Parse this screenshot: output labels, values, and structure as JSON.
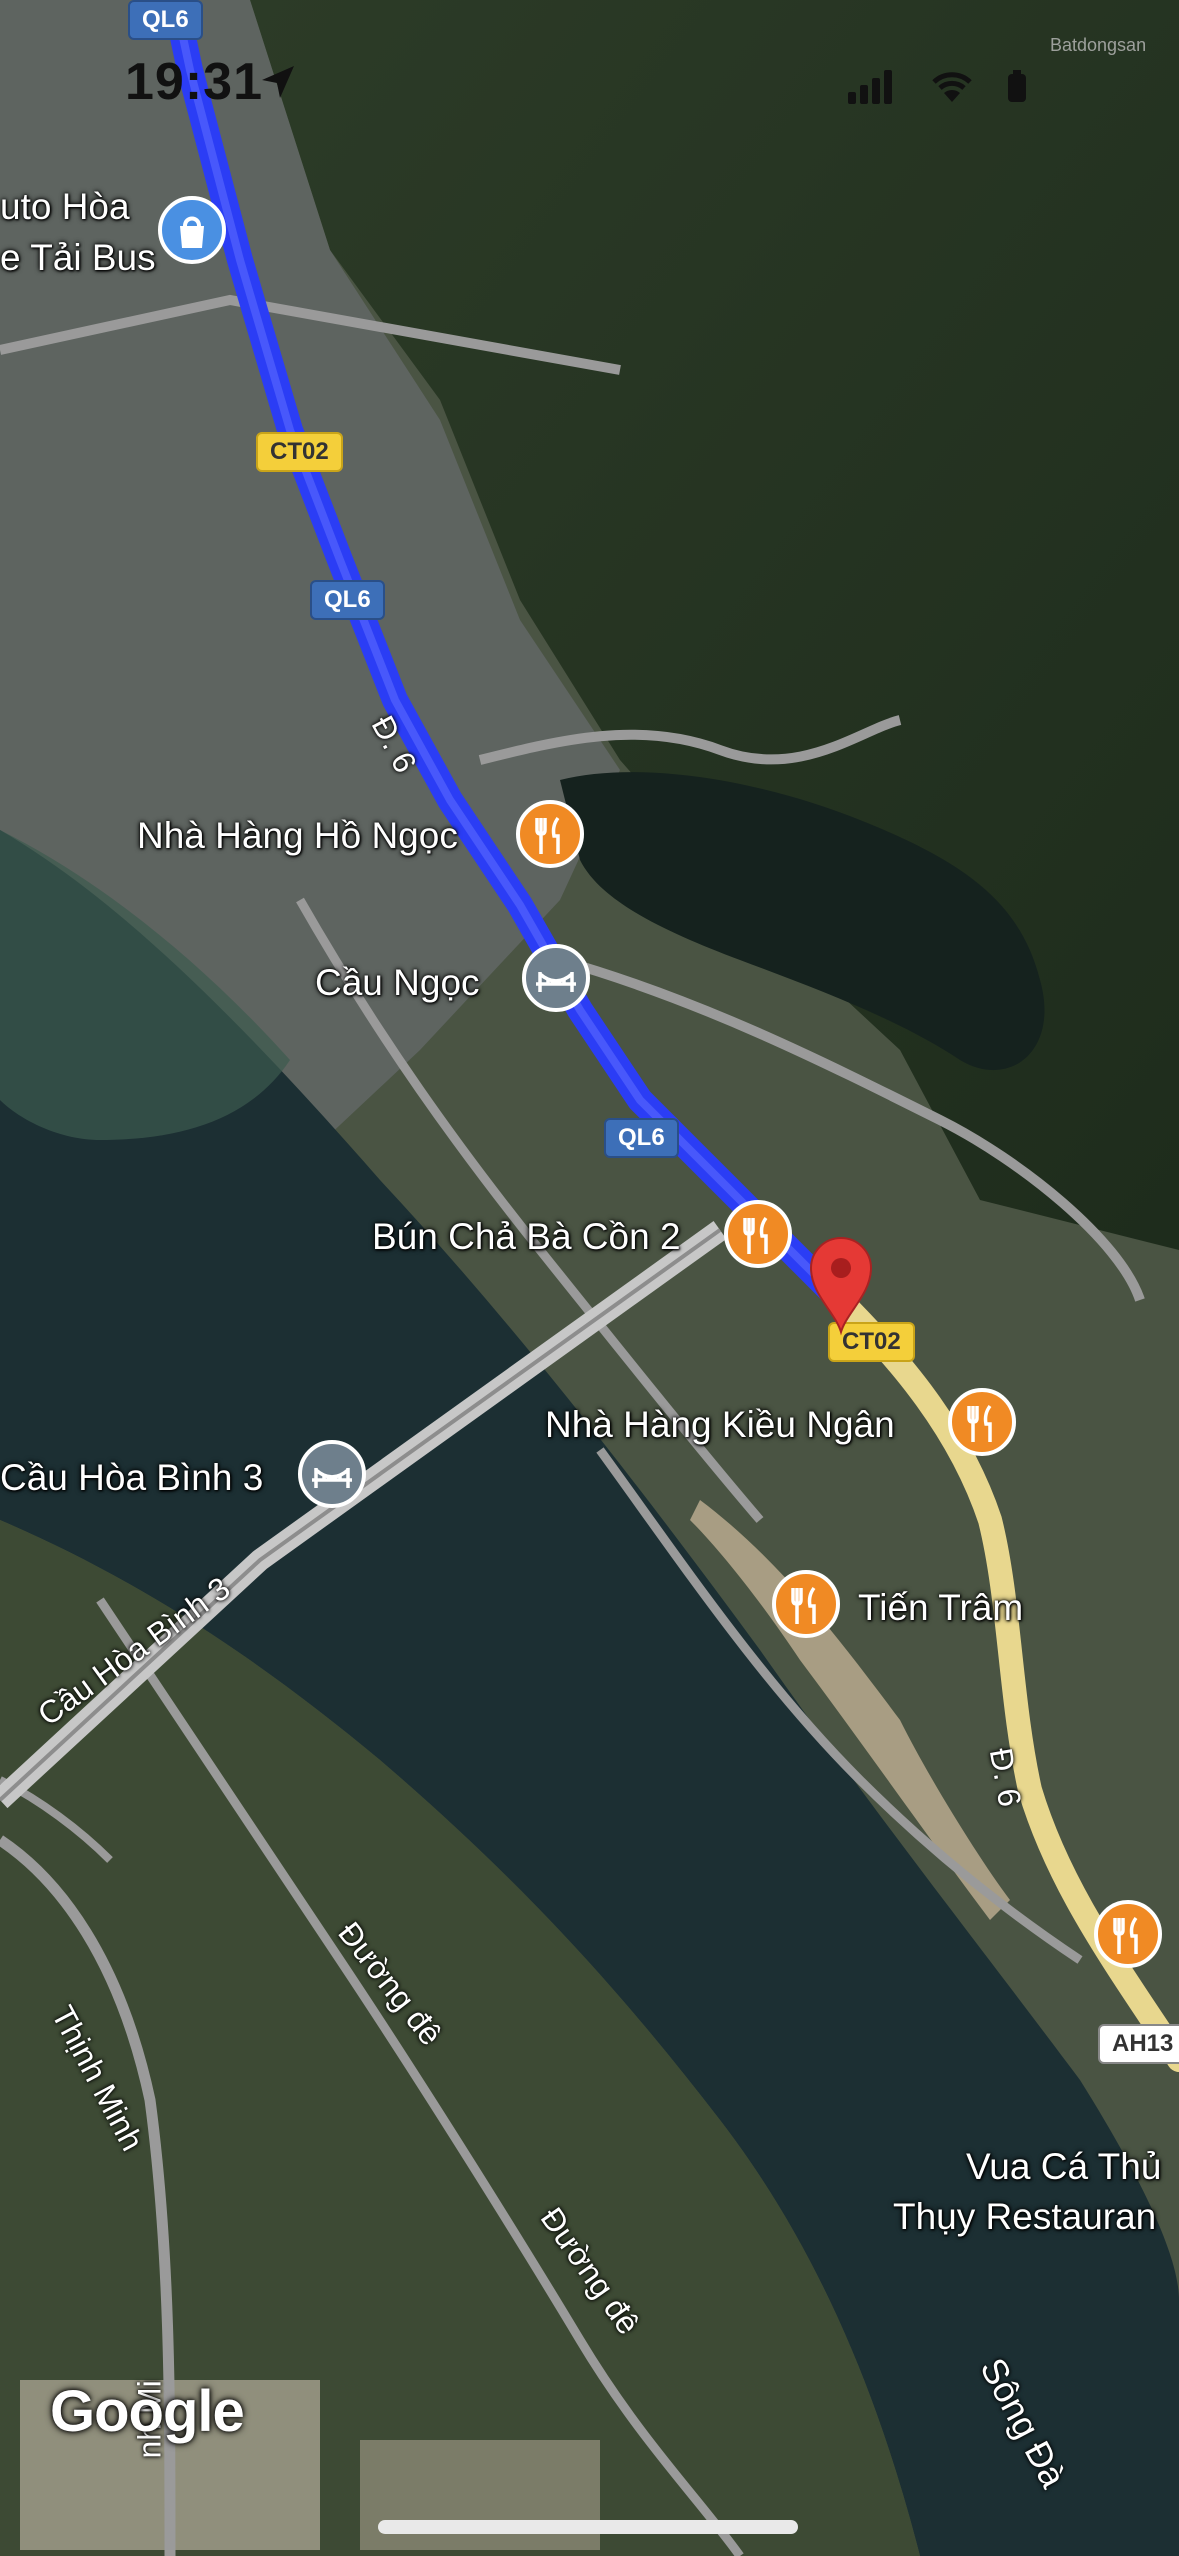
{
  "status_bar": {
    "time": "19:31",
    "watermark": "Batdongsan"
  },
  "route": {
    "color": "#2b3df5",
    "secondary_color": "#e8d78e"
  },
  "road_shields": [
    {
      "text": "QL6",
      "kind": "blue"
    },
    {
      "text": "CT02",
      "kind": "yellow"
    },
    {
      "text": "QL6",
      "kind": "blue"
    },
    {
      "text": "QL6",
      "kind": "blue"
    },
    {
      "text": "CT02",
      "kind": "yellow"
    },
    {
      "text": "AH13",
      "kind": "white"
    }
  ],
  "places": [
    {
      "name": "uto Hòa",
      "icon": "shopping-bag-icon"
    },
    {
      "name": "e Tải Bus",
      "icon": ""
    },
    {
      "name": "Nhà Hàng Hồ Ngọc",
      "icon": "restaurant-icon"
    },
    {
      "name": "Cầu Ngọc",
      "icon": "bridge-icon"
    },
    {
      "name": "Bún Chả Bà Cồn 2",
      "icon": "restaurant-icon"
    },
    {
      "name": "Nhà Hàng Kiều Ngân",
      "icon": "restaurant-icon"
    },
    {
      "name": "Cầu Hòa Bình 3",
      "icon": "bridge-icon"
    },
    {
      "name": "Tiến Trâm",
      "icon": "restaurant-icon"
    },
    {
      "name": "Vua Cá Thủ",
      "icon": "restaurant-icon"
    },
    {
      "name": "Thụy Restauran",
      "icon": ""
    }
  ],
  "street_labels": [
    "Đ. 6",
    "Đ. 6",
    "Cầu Hòa Bình 3",
    "Đường đê",
    "Đường đê",
    "Thịnh Minh",
    "Sông Đà",
    "nh Mi"
  ],
  "logo": "Google",
  "colors": {
    "poi_restaurant": "#f08a24",
    "poi_bridge": "#6e7f8c",
    "pin": "#e53935",
    "river": "#1c2f33"
  }
}
